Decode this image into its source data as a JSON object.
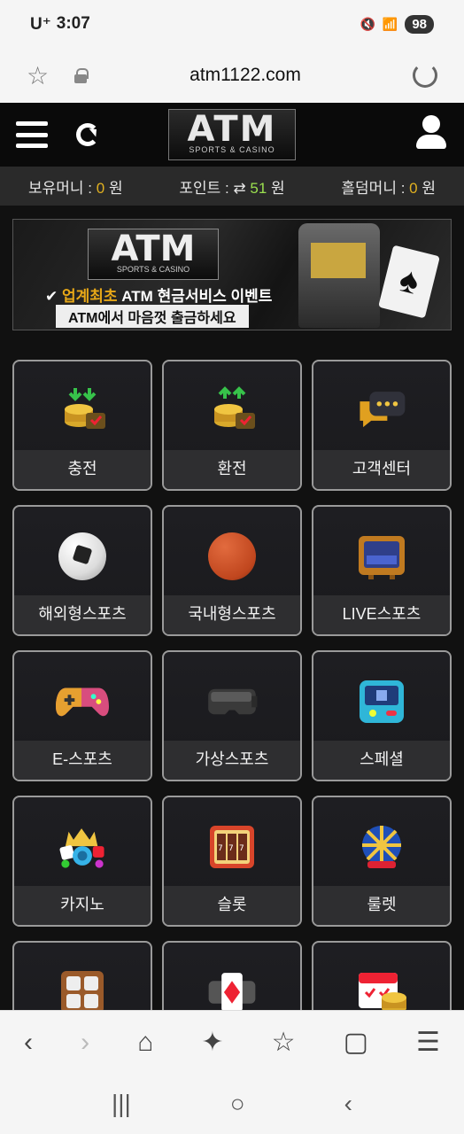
{
  "status_bar": {
    "carrier": "U⁺",
    "time": "3:07",
    "battery": "98"
  },
  "browser": {
    "url": "atm1122.com"
  },
  "header": {
    "logo_text": "ATM",
    "logo_sub": "SPORTS & CASINO"
  },
  "info": {
    "money_label": "보유머니 :",
    "money_value": "0",
    "money_unit": "원",
    "point_label": "포인트 : ⇄",
    "point_value": "51",
    "point_unit": "원",
    "hold_label": "홀덤머니 :",
    "hold_value": "0",
    "hold_unit": "원"
  },
  "banner": {
    "logo": "ATM",
    "logo_sub": "SPORTS & CASINO",
    "check": "✔",
    "highlight": "업계최초",
    "line1": "ATM 현금서비스 이벤트",
    "line2": "ATM에서 마음껏 출금하세요"
  },
  "tiles": [
    {
      "label": "충전",
      "icon": "deposit-coins-icon"
    },
    {
      "label": "환전",
      "icon": "withdraw-coins-icon"
    },
    {
      "label": "고객센터",
      "icon": "chat-bubble-icon"
    },
    {
      "label": "해외형스포츠",
      "icon": "soccer-ball-icon"
    },
    {
      "label": "국내형스포츠",
      "icon": "basketball-icon"
    },
    {
      "label": "LIVE스포츠",
      "icon": "tv-icon"
    },
    {
      "label": "E-스포츠",
      "icon": "gamepad-icon"
    },
    {
      "label": "가상스포츠",
      "icon": "vr-headset-icon"
    },
    {
      "label": "스페셜",
      "icon": "arcade-icon"
    },
    {
      "label": "카지노",
      "icon": "casino-chips-icon"
    },
    {
      "label": "슬롯",
      "icon": "slot-machine-icon"
    },
    {
      "label": "룰렛",
      "icon": "roulette-wheel-icon"
    }
  ],
  "colors": {
    "accent_gold": "#e0b020",
    "accent_green": "#9be04f",
    "bg": "#111111"
  }
}
